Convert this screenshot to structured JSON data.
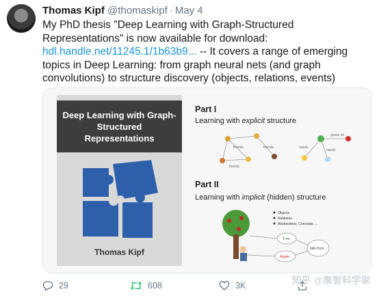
{
  "tweet": {
    "author_name": "Thomas Kipf",
    "author_handle": "@thomaskipf",
    "separator": "·",
    "date": "May 4",
    "text_line1": "My PhD thesis \"Deep Learning with Graph-Structured",
    "text_line2": "Representations\" is now available for download:",
    "link": "hdl.handle.net/11245.1/1b63b9...",
    "text_after_link": " -- It covers a range of emerging",
    "text_line4": "topics in Deep Learning: from graph neural nets (and graph",
    "text_line5": "convolutions) to structure discovery (objects, relations, events)"
  },
  "card": {
    "book_title": "Deep Learning with Graph-Structured Representations",
    "book_author": "Thomas Kipf",
    "part1_title": "Part I",
    "part1_subtitle_pre": "Learning with ",
    "part1_subtitle_em": "explicit",
    "part1_subtitle_post": " structure",
    "part2_title": "Part II",
    "part2_subtitle_pre": "Learning with ",
    "part2_subtitle_em": "implicit",
    "part2_subtitle_post": " (hidden) structure",
    "graph1_labels": [
      "friends",
      "friends",
      "friends"
    ],
    "graph2_labels": [
      "grows on",
      "needs",
      "needs"
    ],
    "list_items": [
      "Objects",
      "Relations",
      "Abstractions, Concepts, ..."
    ],
    "bubble_labels": [
      "Tree",
      "Apple",
      "falls from..."
    ]
  },
  "actions": {
    "replies": "29",
    "retweets": "608",
    "likes": "3K"
  },
  "watermark": "知乎 @集智科学家",
  "colors": {
    "link": "#1b95e0",
    "muted": "#657786",
    "retweet_icon": "#17bf63",
    "puzzle": "#2e5faa"
  }
}
